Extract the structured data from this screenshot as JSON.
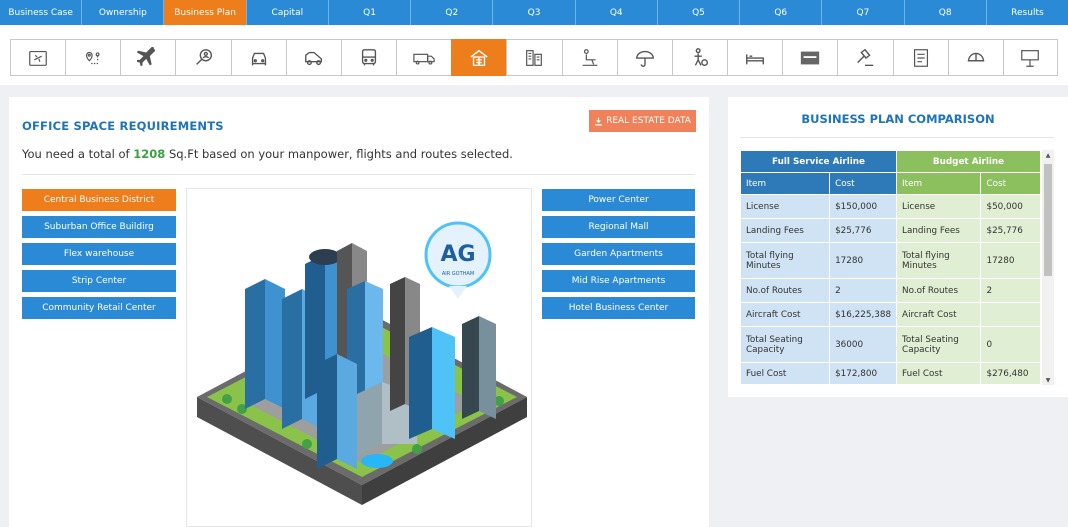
{
  "topnav": {
    "tabs": [
      "Business Case",
      "Ownership",
      "Business Plan",
      "Capital",
      "Q1",
      "Q2",
      "Q3",
      "Q4",
      "Q5",
      "Q6",
      "Q7",
      "Q8",
      "Results"
    ],
    "active_index": 2
  },
  "iconbar": {
    "icons": [
      "airport-icon",
      "route-map-icon",
      "airplane-icon",
      "search-person-icon",
      "taxi-icon",
      "vehicle-icon",
      "bus-icon",
      "truck-icon",
      "building-icon",
      "office-tower-icon",
      "lounge-icon",
      "weather-icon",
      "catering-icon",
      "hotel-bed-icon",
      "card-icon",
      "auction-icon",
      "checklist-icon",
      "cap-icon",
      "signboard-icon"
    ],
    "active_index": 8
  },
  "office": {
    "title": "OFFICE SPACE REQUIREMENTS",
    "real_estate_button": "REAL ESTATE DATA",
    "requirement_prefix": "You need a total of ",
    "requirement_value": "1208",
    "requirement_suffix": " Sq.Ft based on your manpower, flights and routes selected.",
    "left_options": [
      "Central Business District",
      "Suburban Office Buildirg",
      "Flex warehouse",
      "Strip Center",
      "Community Retail Center"
    ],
    "right_options": [
      "Power Center",
      "Regional Mall",
      "Garden Apartments",
      "Mid Rise Apartments",
      "Hotel Business Center"
    ],
    "selected": "Central Business District",
    "logo_letters": "AG",
    "logo_text": "AIR GOTHAM"
  },
  "comparison": {
    "title": "BUSINESS PLAN COMPARISON",
    "full_label": "Full Service Airline",
    "budget_label": "Budget Airline",
    "col_item": "Item",
    "col_cost": "Cost",
    "rows": [
      {
        "f_item": "License",
        "f_cost": "$150,000",
        "b_item": "License",
        "b_cost": "$50,000"
      },
      {
        "f_item": "Landing Fees",
        "f_cost": "$25,776",
        "b_item": "Landing Fees",
        "b_cost": "$25,776"
      },
      {
        "f_item": "Total flying Minutes",
        "f_cost": "17280",
        "b_item": "Total flying Minutes",
        "b_cost": "17280"
      },
      {
        "f_item": "No.of Routes",
        "f_cost": "2",
        "b_item": "No.of Routes",
        "b_cost": "2"
      },
      {
        "f_item": "Aircraft Cost",
        "f_cost": "$16,225,388",
        "b_item": "Aircraft Cost",
        "b_cost": ""
      },
      {
        "f_item": "Total Seating Capacity",
        "f_cost": "36000",
        "b_item": "Total Seating Capacity",
        "b_cost": "0"
      },
      {
        "f_item": "Fuel Cost",
        "f_cost": "$172,800",
        "b_item": "Fuel Cost",
        "b_cost": "$276,480"
      }
    ]
  },
  "colors": {
    "primary_blue": "#2b8ad6",
    "accent_orange": "#ee7d1c",
    "title_blue": "#1f74b8",
    "highlight_green": "#3aa043",
    "budget_green": "#8cbf5e"
  }
}
